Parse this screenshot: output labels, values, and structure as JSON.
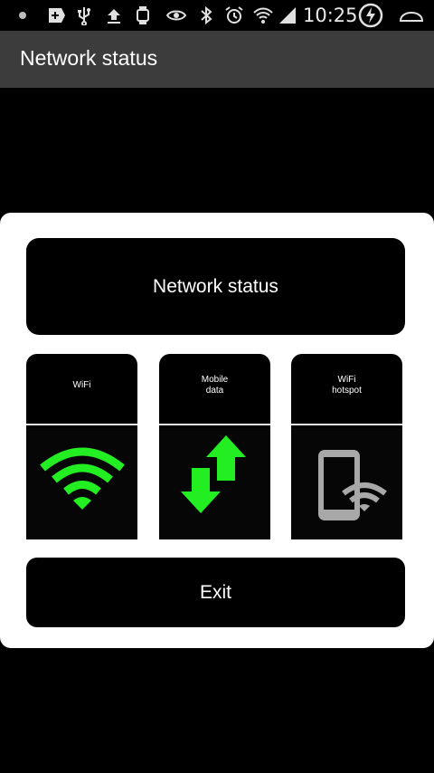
{
  "status_bar": {
    "time": "10:25",
    "icons": [
      "notification-dot-icon",
      "battery-saver-plus-icon",
      "usb-icon",
      "upload-icon",
      "smartwatch-icon",
      "eye-icon",
      "bluetooth-icon",
      "alarm-icon",
      "wifi-signal-icon",
      "cell-signal-icon",
      "charging-icon",
      "home-arc-icon"
    ]
  },
  "action_bar": {
    "title": "Network status"
  },
  "dialog": {
    "header_label": "Network status",
    "tiles": [
      {
        "label": "WiFi",
        "icon": "wifi-icon"
      },
      {
        "label": "Mobile\ndata",
        "icon": "mobile-data-arrows-icon"
      },
      {
        "label": "WiFi\nhotspot",
        "icon": "wifi-hotspot-phone-icon"
      }
    ],
    "exit_label": "Exit"
  },
  "colors": {
    "accent_green": "#22ee22",
    "background": "#000000",
    "dialog": "#ffffff"
  }
}
